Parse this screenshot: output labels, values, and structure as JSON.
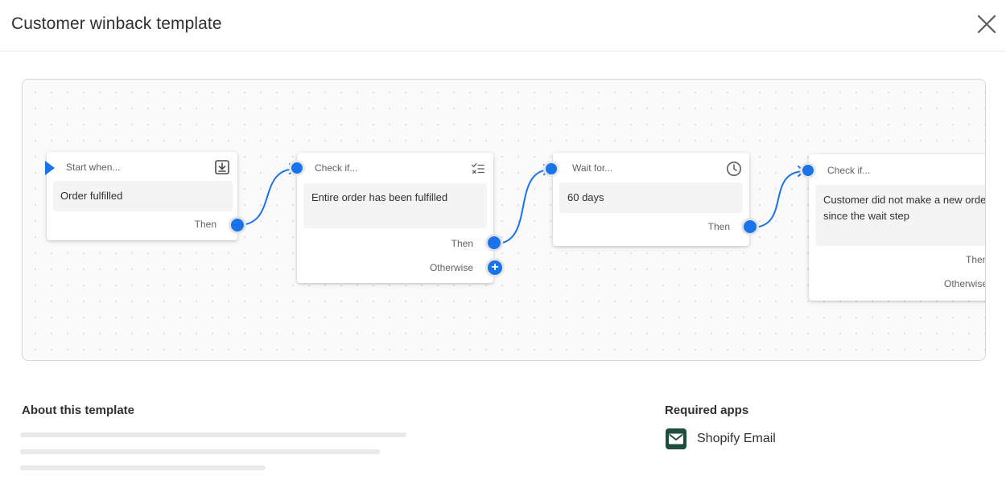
{
  "header": {
    "title": "Customer winback template"
  },
  "icons": {
    "close": "close-icon",
    "trigger": "download-icon",
    "condition": "checklist-icon",
    "wait": "clock-icon",
    "add": "plus-icon",
    "app": "envelope-icon"
  },
  "colors": {
    "accent": "#1a73e8",
    "text": "#303030",
    "muted": "#616161",
    "app_icon_bg": "#1e4d3b"
  },
  "workflow": {
    "nodes": [
      {
        "label": "Start when...",
        "value": "Order fulfilled",
        "outputs": [
          "Then"
        ]
      },
      {
        "label": "Check if...",
        "value": "Entire order has been fulfilled",
        "outputs": [
          "Then",
          "Otherwise"
        ]
      },
      {
        "label": "Wait for...",
        "value": "60 days",
        "outputs": [
          "Then"
        ]
      },
      {
        "label": "Check if...",
        "value": "Customer did not make a new order since the wait step",
        "outputs": [
          "Then",
          "Otherwise"
        ]
      }
    ]
  },
  "about": {
    "title": "About this template"
  },
  "required_apps": {
    "title": "Required apps",
    "apps": [
      {
        "name": "Shopify Email"
      }
    ]
  }
}
